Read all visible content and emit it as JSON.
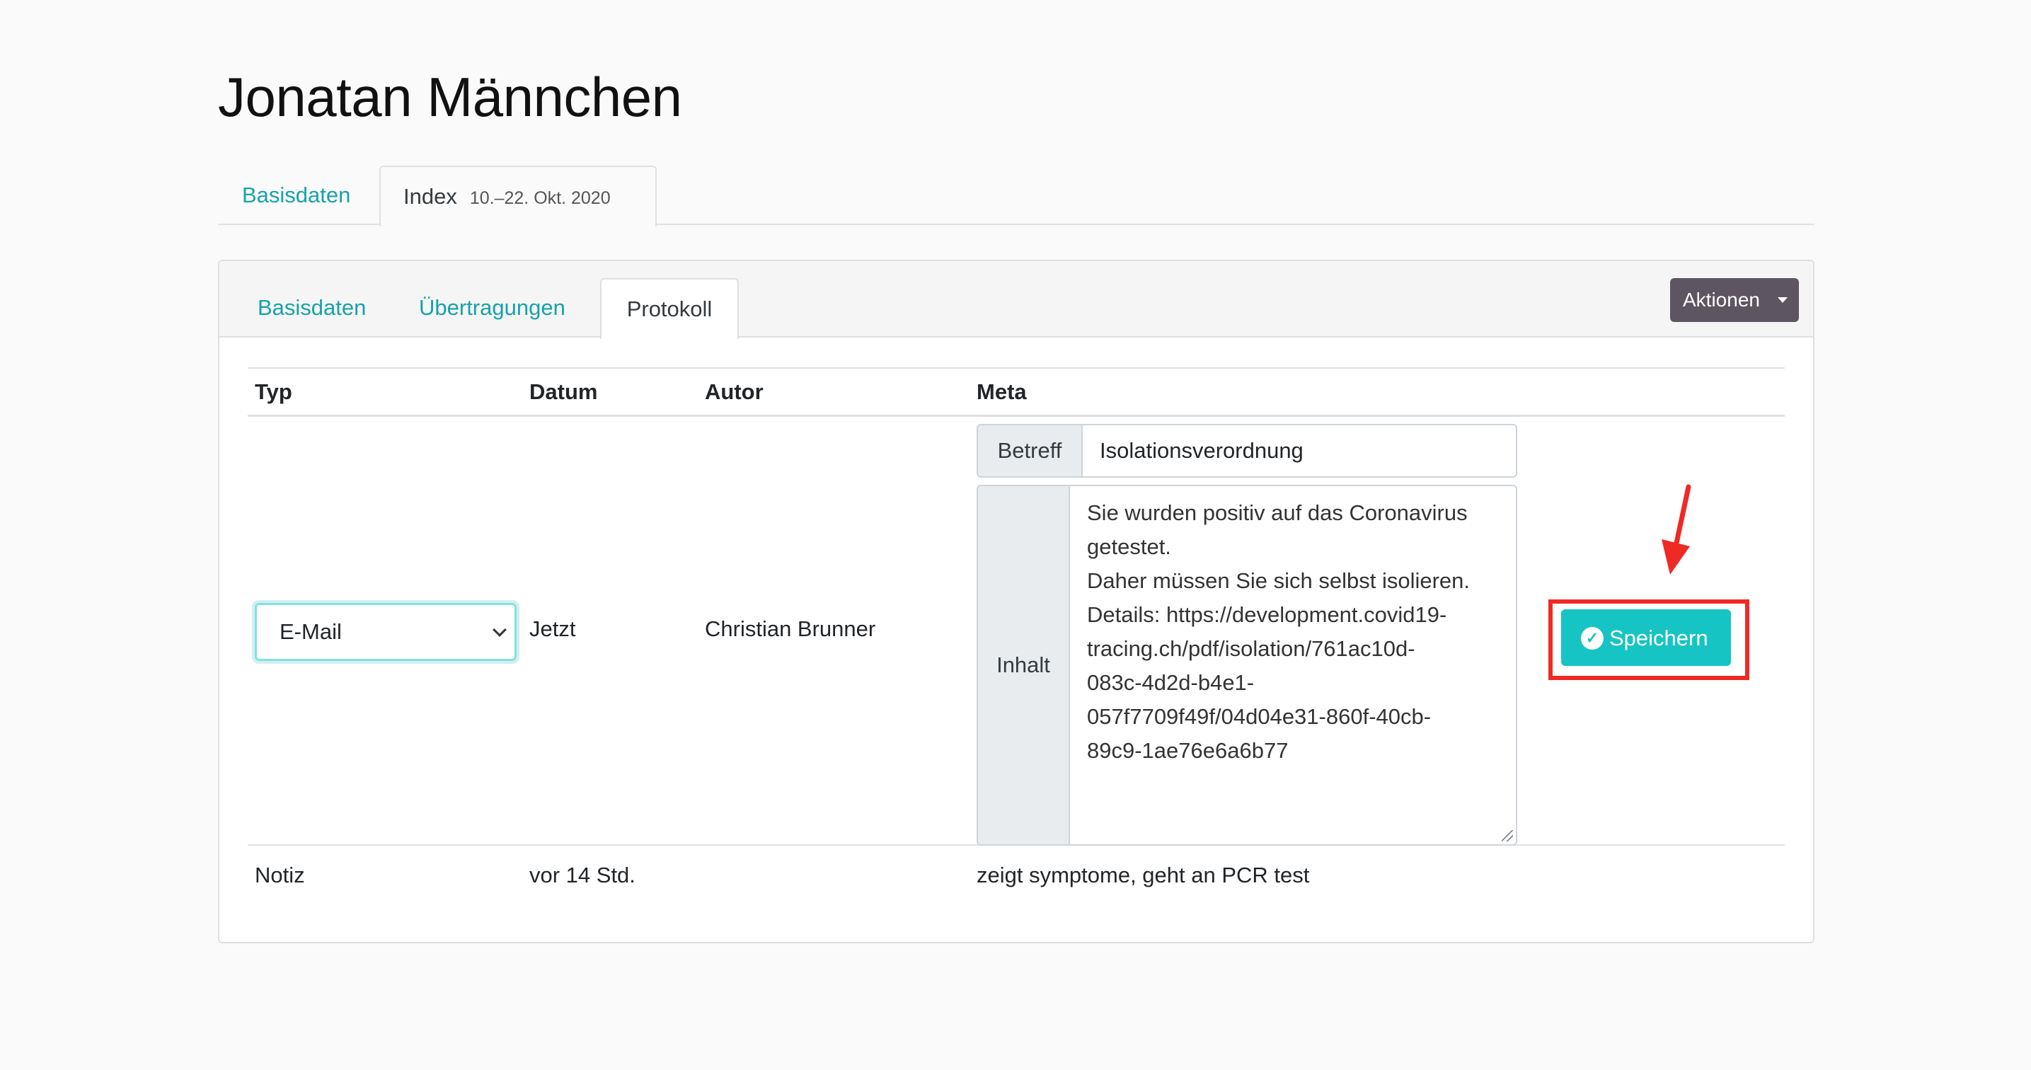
{
  "page": {
    "title": "Jonatan Männchen"
  },
  "top_tabs": [
    {
      "label": "Basisdaten",
      "sub": ""
    },
    {
      "label": "Index",
      "sub": "10.–22. Okt. 2020"
    }
  ],
  "inner_tabs": [
    {
      "label": "Basisdaten"
    },
    {
      "label": "Übertragungen"
    },
    {
      "label": "Protokoll"
    }
  ],
  "actions": {
    "label": "Aktionen"
  },
  "table": {
    "headers": [
      "Typ",
      "Datum",
      "Autor",
      "Meta"
    ],
    "edit_row": {
      "type_selected": "E-Mail",
      "date": "Jetzt",
      "author": "Christian Brunner",
      "subject_label": "Betreff",
      "subject_value": "Isolationsverordnung",
      "content_label": "Inhalt",
      "content_value": "Sie wurden positiv auf das Coronavirus\ngetestet.\nDaher müssen Sie sich selbst isolieren.\nDetails: https://development.covid19-\ntracing.ch/pdf/isolation/761ac10d-\n083c-4d2d-b4e1-\n057f7709f49f/04d04e31-860f-40cb-\n89c9-1ae76e6a6b77",
      "save_label": "Speichern"
    },
    "rows": [
      {
        "type": "Notiz",
        "date": "vor 14 Std.",
        "author": "",
        "meta": "zeigt symptome, geht an PCR test"
      }
    ]
  },
  "colors": {
    "accent": "#17a2a8",
    "save_button": "#17c4c4",
    "actions_button": "#5d5560",
    "highlight": "#ef2a24"
  }
}
